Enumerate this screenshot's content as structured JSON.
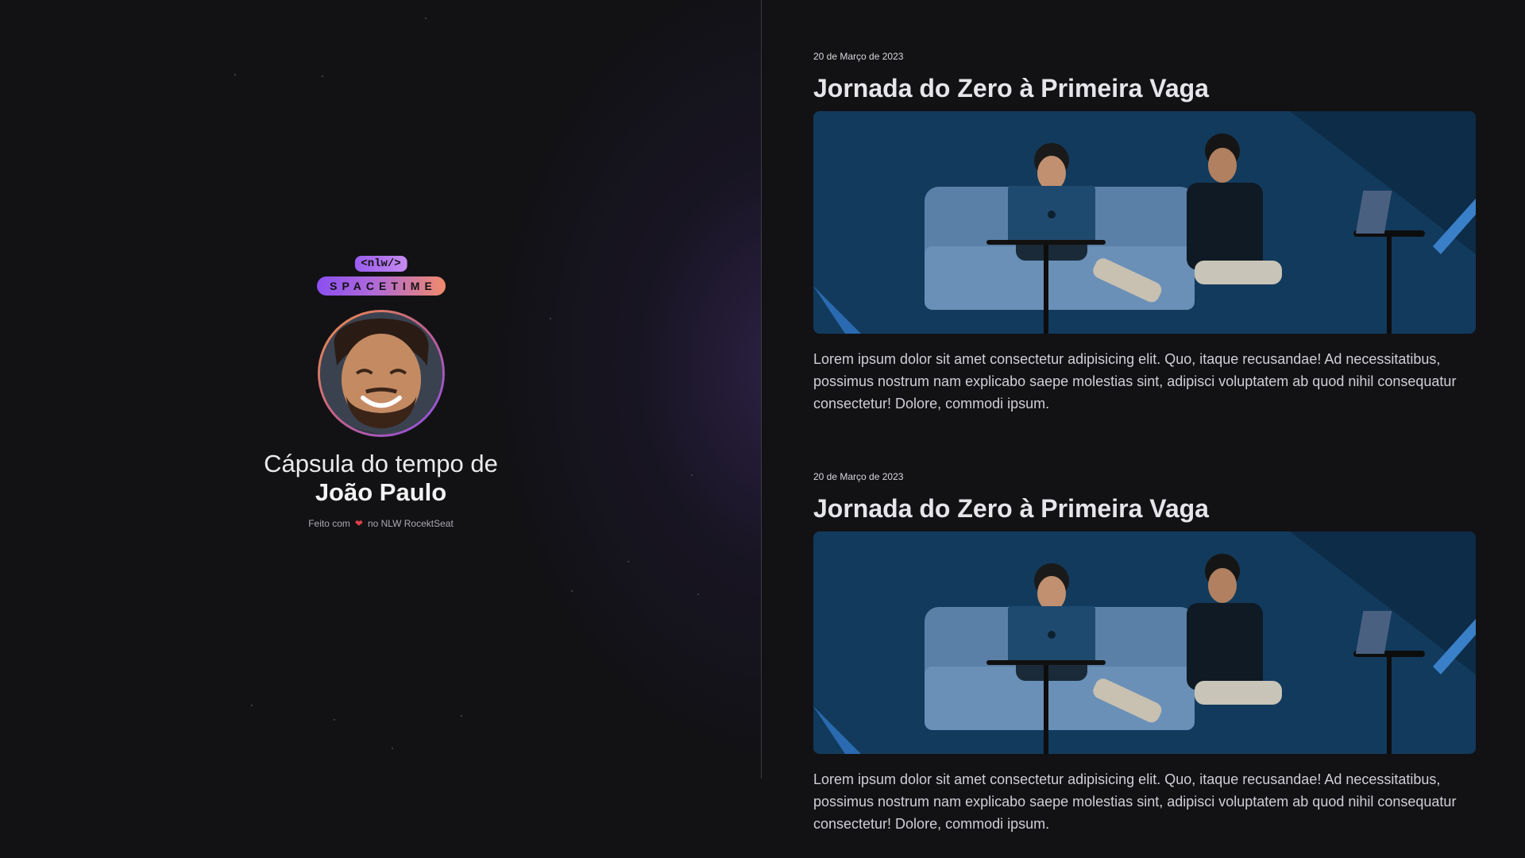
{
  "profile": {
    "logo_tag": "<nlw/>",
    "logo_word": "SPACETIME",
    "capsule_prefix": "Cápsula do tempo de",
    "name": "João Paulo",
    "footer_before": "Feito com",
    "footer_after": "no NLW RocektSeat"
  },
  "memories": [
    {
      "date": "20 de Março de 2023",
      "title": "Jornada do Zero à Primeira Vaga",
      "text": "Lorem ipsum dolor sit amet consectetur adipisicing elit. Quo, itaque recusandae! Ad necessitatibus, possimus nostrum nam explicabo saepe molestias sint, adipisci voluptatem ab quod nihil consequatur consectetur! Dolore, commodi ipsum."
    },
    {
      "date": "20 de Março de 2023",
      "title": "Jornada do Zero à Primeira Vaga",
      "text": "Lorem ipsum dolor sit amet consectetur adipisicing elit. Quo, itaque recusandae! Ad necessitatibus, possimus nostrum nam explicabo saepe molestias sint, adipisci voluptatem ab quod nihil consequatur consectetur! Dolore, commodi ipsum."
    }
  ],
  "icons": {
    "heart": "heart-icon"
  },
  "colors": {
    "accent_purple": "#8a4ff0",
    "accent_orange": "#f09046",
    "background": "#121215"
  }
}
